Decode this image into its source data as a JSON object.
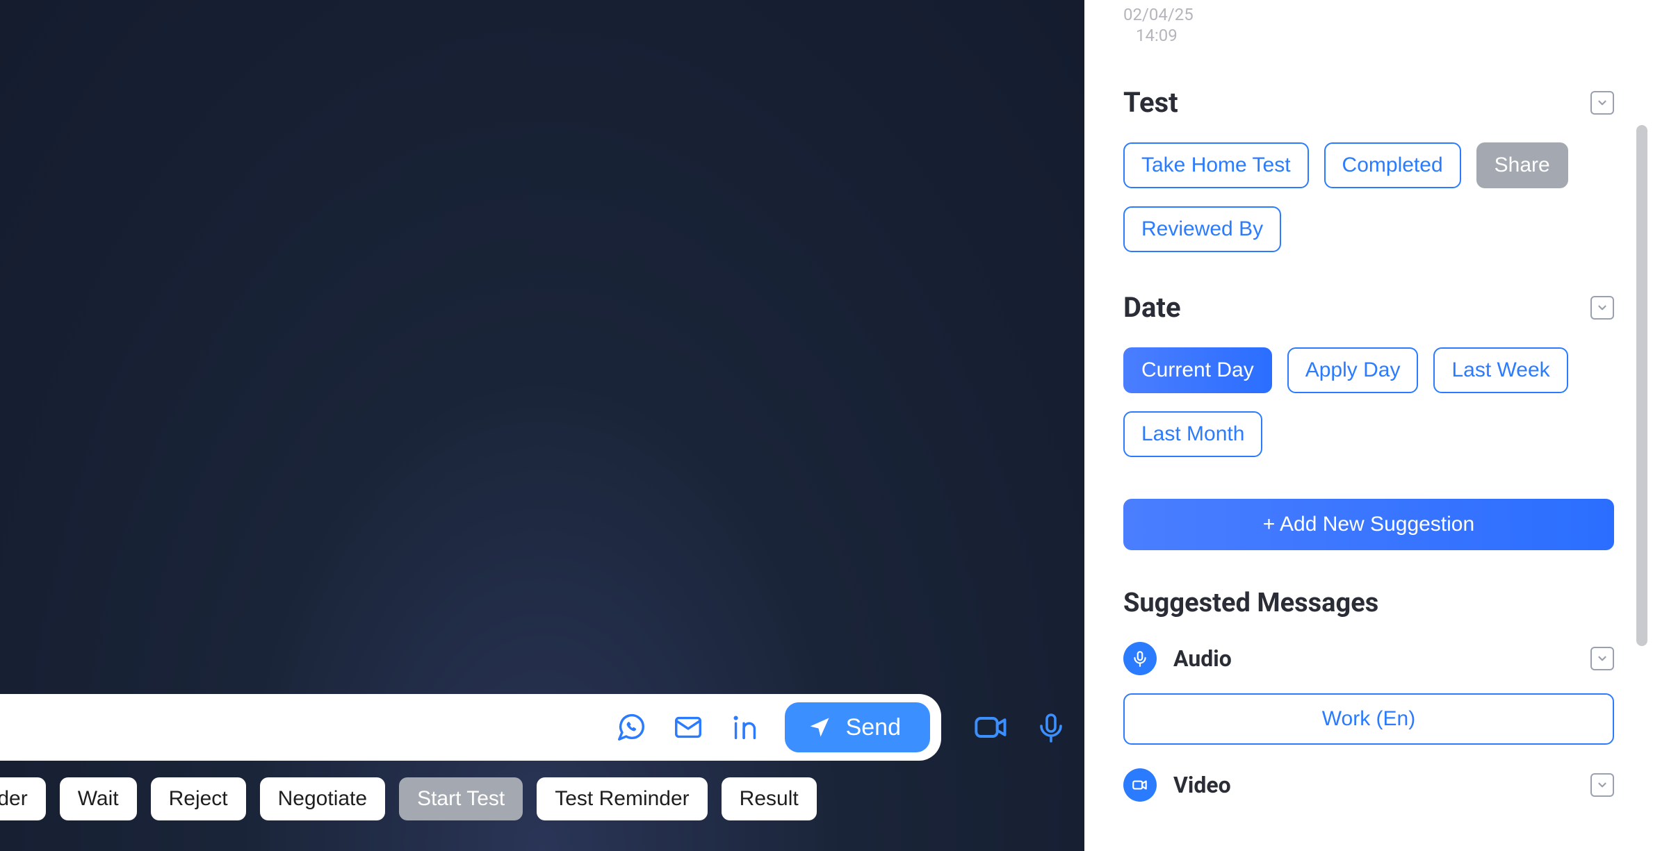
{
  "timestamp": {
    "date": "02/04/25",
    "time": "14:09"
  },
  "sections": {
    "test": {
      "title": "Test",
      "tags": [
        "Take Home Test",
        "Completed",
        "Share",
        "Reviewed By"
      ]
    },
    "date": {
      "title": "Date",
      "tags": [
        "Current Day",
        "Apply Day",
        "Last Week",
        "Last Month"
      ]
    }
  },
  "add_suggestion_label": "+ Add New Suggestion",
  "suggested": {
    "title": "Suggested Messages",
    "audio_label": "Audio",
    "video_label": "Video",
    "work_label": "Work  (En)"
  },
  "composer": {
    "send_label": "Send"
  },
  "chips": [
    "minder",
    "Wait",
    "Reject",
    "Negotiate",
    "Start Test",
    "Test Reminder",
    "Result"
  ]
}
